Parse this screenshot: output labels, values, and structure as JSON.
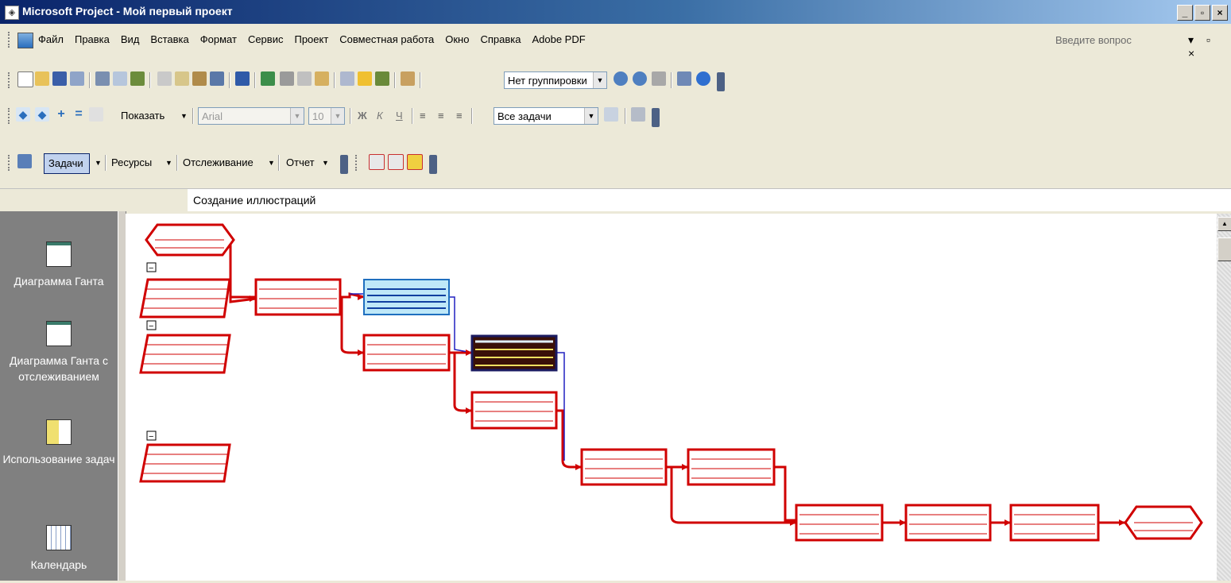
{
  "window": {
    "title": "Microsoft Project - Мой первый проект"
  },
  "menu": {
    "items": [
      "Файл",
      "Правка",
      "Вид",
      "Вставка",
      "Формат",
      "Сервис",
      "Проект",
      "Совместная работа",
      "Окно",
      "Справка",
      "Adobe PDF"
    ],
    "help_placeholder": "Введите вопрос"
  },
  "toolbar_standard": {
    "grouping_value": "Нет группировки"
  },
  "toolbar_formatting": {
    "show_label": "Показать",
    "font": "Arial",
    "size": "10",
    "bold": "Ж",
    "italic": "К",
    "underline": "Ч",
    "filter_value": "Все задачи"
  },
  "toolbar_guide": {
    "tasks": "Задачи",
    "resources": "Ресурсы",
    "tracking": "Отслеживание",
    "report": "Отчет"
  },
  "entry_bar": {
    "value": "Создание иллюстраций"
  },
  "view_bar": {
    "items": [
      "Диаграмма Ганта",
      "Диаграмма Ганта с отслеживанием",
      "Использование задач",
      "Календарь"
    ]
  },
  "network": {
    "collapse_symbol": "−"
  }
}
